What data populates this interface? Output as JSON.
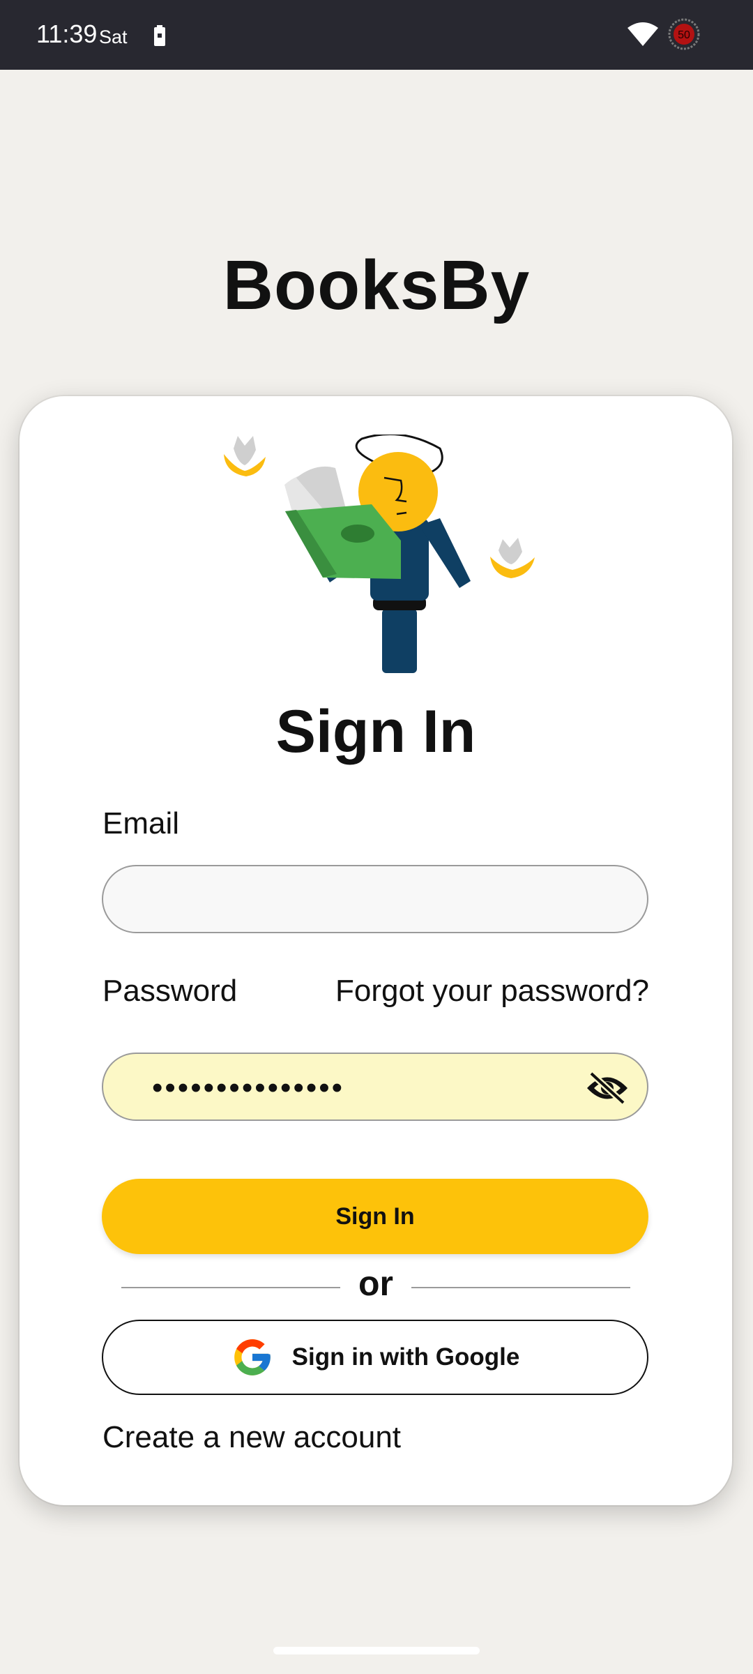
{
  "status_bar": {
    "time": "11:39",
    "day": "Sat",
    "icons": [
      "battery-icon",
      "wifi-icon",
      "data-saver-icon"
    ],
    "data_saver_value": "50"
  },
  "app": {
    "title": "BooksBy"
  },
  "form": {
    "heading": "Sign In",
    "email_label": "Email",
    "email_value": "",
    "password_label": "Password",
    "forgot_link": "Forgot your password?",
    "password_mask": "•••••••••••••••",
    "sign_in_button": "Sign In",
    "divider_text": "or",
    "google_button": "Sign in with Google",
    "create_account_link": "Create a new account"
  },
  "colors": {
    "background": "#f2f0ec",
    "accent": "#fdc20a",
    "password_fill": "#fcf8c6",
    "figure_shirt": "#0f3f63",
    "book_green": "#4caf50"
  }
}
